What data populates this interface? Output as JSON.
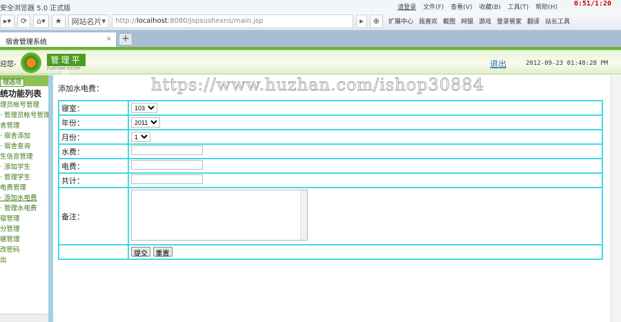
{
  "browser": {
    "title": "安全浏览器 5.0 正式版",
    "login": "请登录",
    "menus": [
      "文件(F)",
      "查看(V)",
      "收藏(B)",
      "工具(T)",
      "帮助(H)"
    ],
    "clock": "0:51/1:20",
    "url_prefix": "http://",
    "url_host": "localhost",
    "url_rest": ":8080/jspsushexns/main.jsp",
    "site_card": "网站名片",
    "extensions": [
      "扩展中心",
      "我喜欢",
      "截图",
      "网银",
      "游戏",
      "登录管家",
      "翻译",
      "站长工具"
    ],
    "tab": "宿舍管理系统"
  },
  "header": {
    "welcome": "迎您-",
    "logo": "管理平台",
    "logo_sub": "PLATFORM SYSTEM",
    "logout": "退出",
    "datetime": "2012-09-23 01:48:28 PM"
  },
  "sidebar": {
    "tab": "理选项",
    "title": "统功能列表",
    "items": [
      "理员帐号管理",
      "· 管理员帐号管理",
      "舍管理",
      "· 宿舍添加",
      "· 宿舍查询",
      "生信息管理",
      "· 添加学生",
      "· 管理学生",
      "电费管理",
      "· 添加水电费",
      "· 管理水电费",
      "宿管理",
      "分管理",
      "据管理",
      "改密码",
      "出"
    ]
  },
  "form": {
    "title": "添加水电费：",
    "watermark": "https://www.huzhan.com/ishop30884",
    "labels": {
      "dorm": "寝室：",
      "year": "年份：",
      "month": "月份：",
      "water": "水费：",
      "electric": "电费：",
      "total": "共计：",
      "remark": "备注："
    },
    "dorm": "103",
    "year": "2011",
    "month": "1",
    "water": "",
    "electric": "",
    "total": "",
    "submit": "提交",
    "reset": "重置"
  }
}
